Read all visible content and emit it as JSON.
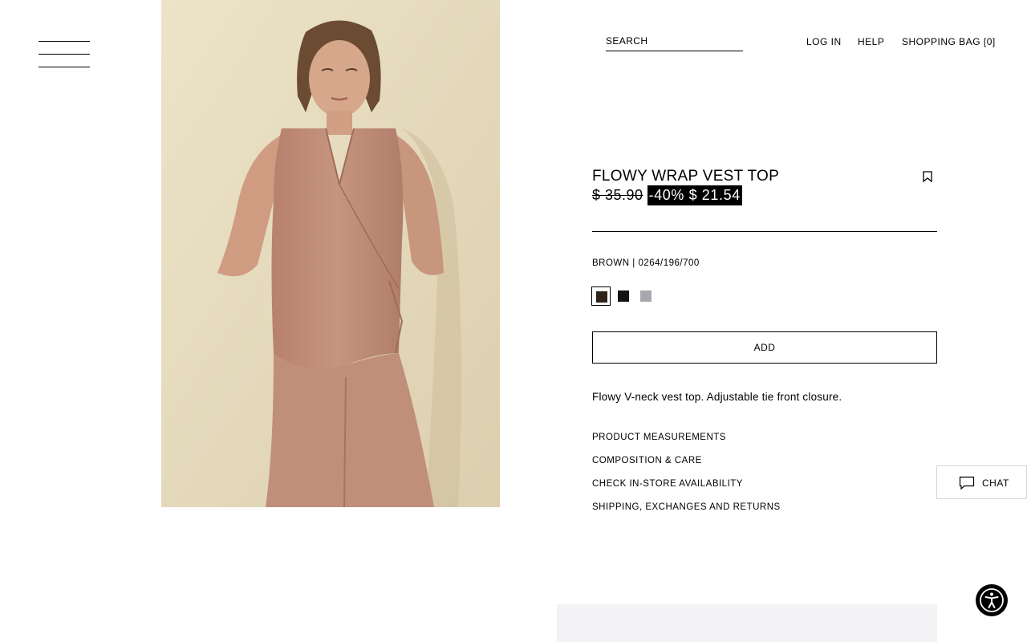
{
  "header": {
    "menu_icon": "hamburger-icon",
    "search_placeholder": "SEARCH",
    "login_label": "LOG IN",
    "help_label": "HELP",
    "bag_label": "SHOPPING BAG [0]"
  },
  "product": {
    "image_icon": "product-photo",
    "title": "FLOWY WRAP VEST TOP",
    "bookmark_icon": "bookmark-icon",
    "price_old": "$ 35.90",
    "price_sale": "-40% $ 21.54",
    "color_ref": "BROWN | 0264/196/700",
    "swatches": [
      {
        "name": "brown",
        "color": "#2e2419",
        "selected": true
      },
      {
        "name": "black",
        "color": "#141414",
        "selected": false
      },
      {
        "name": "grey",
        "color": "#a8a8b0",
        "selected": false
      }
    ],
    "add_label": "ADD",
    "description": "Flowy V-neck vest top. Adjustable tie front closure.",
    "info_links": [
      "PRODUCT MEASUREMENTS",
      "COMPOSITION & CARE",
      "CHECK IN-STORE AVAILABILITY",
      "SHIPPING, EXCHANGES AND RETURNS"
    ]
  },
  "chat": {
    "label": "CHAT",
    "icon": "chat-bubble-icon"
  },
  "accessibility": {
    "icon": "accessibility-icon"
  },
  "colors": {
    "accent": "#000000",
    "sale_background": "#000000",
    "sale_text": "#ffffff",
    "wall_background": "#e6dcc0",
    "garment": "#c08f7a",
    "panel_background": "#f3f3f5"
  }
}
